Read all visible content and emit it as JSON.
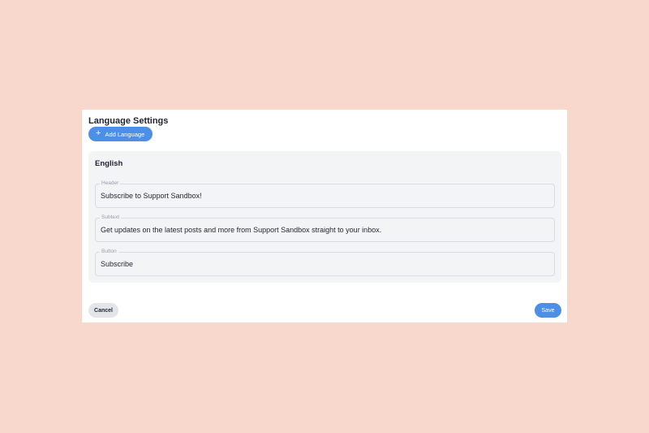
{
  "dialog": {
    "title": "Language Settings",
    "add_language_label": "Add Language",
    "add_icon": "plus-icon"
  },
  "language_card": {
    "name": "English",
    "fields": [
      {
        "label": "Header",
        "value": "Subscribe to Support Sandbox!"
      },
      {
        "label": "Subtext",
        "value": "Get updates on the latest posts and more from Support Sandbox straight to your inbox."
      },
      {
        "label": "Button",
        "value": "Subscribe"
      }
    ]
  },
  "footer": {
    "cancel_label": "Cancel",
    "save_label": "Save"
  },
  "colors": {
    "background": "#f8d7cc",
    "accent": "#4d8fe8",
    "card": "#f3f4f6"
  }
}
